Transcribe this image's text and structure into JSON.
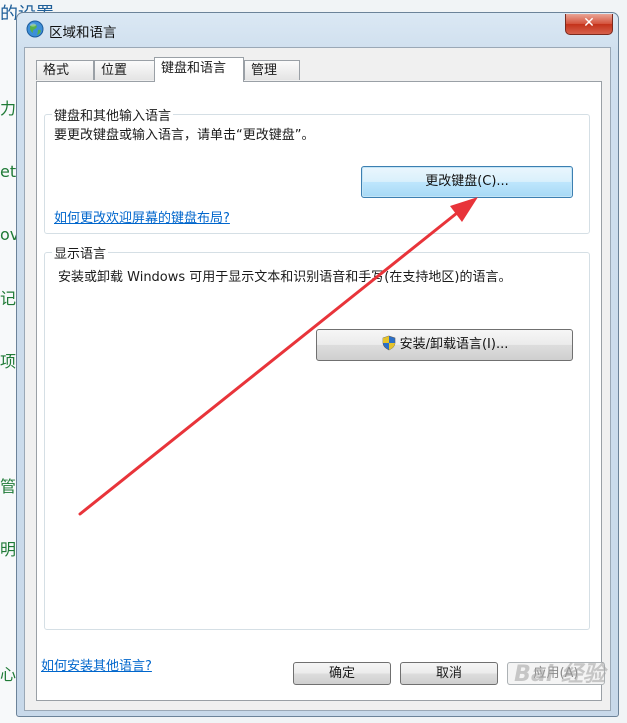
{
  "background": {
    "title_fragment": "的设置",
    "fragments": [
      "力",
      "et",
      "ov",
      "记",
      "项",
      "管理",
      "明",
      "心"
    ]
  },
  "window": {
    "title": "区域和语言",
    "close_glyph": "✕"
  },
  "tabs": [
    {
      "label": "格式"
    },
    {
      "label": "位置"
    },
    {
      "label": "键盘和语言"
    },
    {
      "label": "管理"
    }
  ],
  "keyboard_group": {
    "label": "键盘和其他输入语言",
    "description": "要更改键盘或输入语言，请单击“更改键盘”。",
    "change_keyboard_button": "更改键盘(C)...",
    "welcome_layout_link": "如何更改欢迎屏幕的键盘布局?"
  },
  "display_group": {
    "label": "显示语言",
    "description": "安装或卸载 Windows 可用于显示文本和识别语音和手写(在支持地区)的语言。",
    "install_button": "安装/卸载语言(I)..."
  },
  "other_languages_link": "如何安装其他语言?",
  "footer": {
    "ok": "确定",
    "cancel": "取消",
    "apply": "应用(A)"
  },
  "watermark": "Bai 经验",
  "colors": {
    "link": "#0066cc",
    "arrow": "#e8343a",
    "close_button": "#c4321a"
  }
}
